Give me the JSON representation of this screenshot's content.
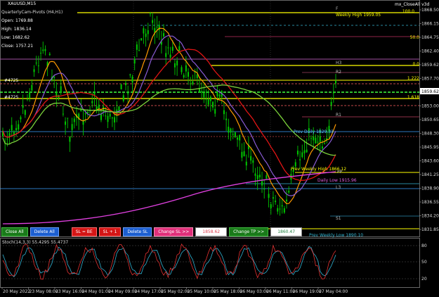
{
  "symbol": "XAUUSD,M15",
  "ea_label": "mx_CloseAll v3d",
  "indicator_title": "QuarterlyCam-Pivots (H4,H1)",
  "info_panel": {
    "open": "Open: 1769.88",
    "high": "High: 1836.14",
    "low": "Low: 1682.62",
    "close": "Close: 1757.21"
  },
  "buttons": {
    "close_all": "Close All",
    "delete_all": "Delete All",
    "sl_be": "SL = BE",
    "sl_plus1": "SL + 1",
    "delete_sl": "Delete SL",
    "change_sl": "Change SL >>",
    "sl_value": "1858.62",
    "change_tp": "Change TP >>",
    "tp_value": "1860.47"
  },
  "price_axis": {
    "labels": [
      "1868.50",
      "1866.15",
      "1864.75",
      "1862.40",
      "1859.62",
      "1857.70",
      "1855.35",
      "1853.00",
      "1850.65",
      "1848.30",
      "1845.95",
      "1843.60",
      "1841.25",
      "1838.90",
      "1836.55",
      "1834.20",
      "1831.85"
    ],
    "current_price": "1859.62",
    "top_tag": "100.0"
  },
  "time_axis": [
    "20 May 2022",
    "23 May 08:00",
    "23 May 16:00",
    "24 May 01:00",
    "24 May 09:00",
    "24 May 17:00",
    "25 May 02:00",
    "25 May 10:00",
    "25 May 18:00",
    "26 May 03:00",
    "26 May 11:00",
    "26 May 19:00",
    "27 May 04:00"
  ],
  "chart_labels": {
    "weekly_high": "Weekly High 1959.05",
    "prev_weekly_high": "Prev Weekly High 1866.12",
    "daily_low": "Daily Low 1915.96",
    "prev_daily": "Prev Daily 1829.33",
    "prev_weekly_low": "Prev Weekly Low 1890.10",
    "level_h3": "H3",
    "level_r2": "R2",
    "level_r1": "R1",
    "level_s1": "S1",
    "level_l3": "L3",
    "level_pp": "PP",
    "fib_1222": "1.222",
    "fib_1618": "1.618",
    "fib_00": "0.0",
    "fib_500": "50.0",
    "order_buy": "#4725",
    "order_sell": "#4725"
  },
  "subwindow": {
    "title": "Stoch(14,3,3) 55.4295 55.4737",
    "levels": [
      "80",
      "50",
      "20"
    ]
  },
  "colors": {
    "background": "#000000",
    "candles": "#00c800",
    "ma_fast": "#ff9a00",
    "ma_mid": "#8a5cd6",
    "ma_slow": "#e01515",
    "ma_long": "#7bd13a",
    "ma_extra": "#e040e0",
    "pivot_yellow": "#ffff00",
    "stoch_main": "#e23030",
    "stoch_signal": "#2fb0d0"
  }
}
